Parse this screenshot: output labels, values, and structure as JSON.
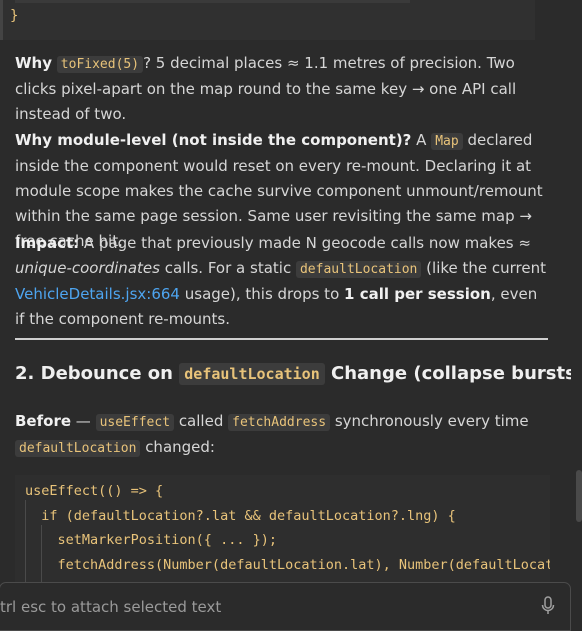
{
  "code_top": {
    "closing_brace": "}"
  },
  "why_tofixed": {
    "lead": "Why",
    "code": "toFixed(5)",
    "text": "? 5 decimal places ≈ 1.1 metres of precision. Two clicks pixel-apart on the map round to the same key → one API call instead of two."
  },
  "why_module": {
    "lead": "Why module-level (not inside the component)?",
    "pre": "A",
    "code": "Map",
    "text": "declared inside the component would reset on every re-mount. Declaring it at module scope makes the cache survive component unmount/remount within the same page session. Same user revisiting the same map → free cache hit."
  },
  "impact": {
    "lead": "Impact:",
    "text1": "A page that previously made N geocode calls now makes ≈",
    "em": "unique-coordinates",
    "text2": "calls. For a static",
    "code": "defaultLocation",
    "text3": "(like the current",
    "link": "VehicleDetails.jsx:664",
    "text4": "usage), this drops to",
    "bold": "1 call per session",
    "text5": ", even if the component re-mounts."
  },
  "section2": {
    "heading_pre": "2. Debounce on",
    "heading_code": "defaultLocation",
    "heading_post": "Change (collapse bursts)"
  },
  "before": {
    "lead": "Before",
    "dash": "—",
    "code1": "useEffect",
    "text1": "called",
    "code2": "fetchAddress",
    "text2": "synchronously every time",
    "code3": "defaultLocation",
    "text3": "changed:"
  },
  "code_block": {
    "lines": [
      "useEffect(() => {",
      "  if (defaultLocation?.lat && defaultLocation?.lng) {",
      "    setMarkerPosition({ ... });",
      "    fetchAddress(Number(defaultLocation.lat), Number(defaultLocat"
    ]
  },
  "input": {
    "placeholder": "trl esc to attach selected text"
  },
  "icons": {
    "mic": "microphone-icon"
  },
  "colors": {
    "background": "#2b2b2b",
    "code_text": "#e8c37a",
    "link": "#4ea5f0"
  }
}
